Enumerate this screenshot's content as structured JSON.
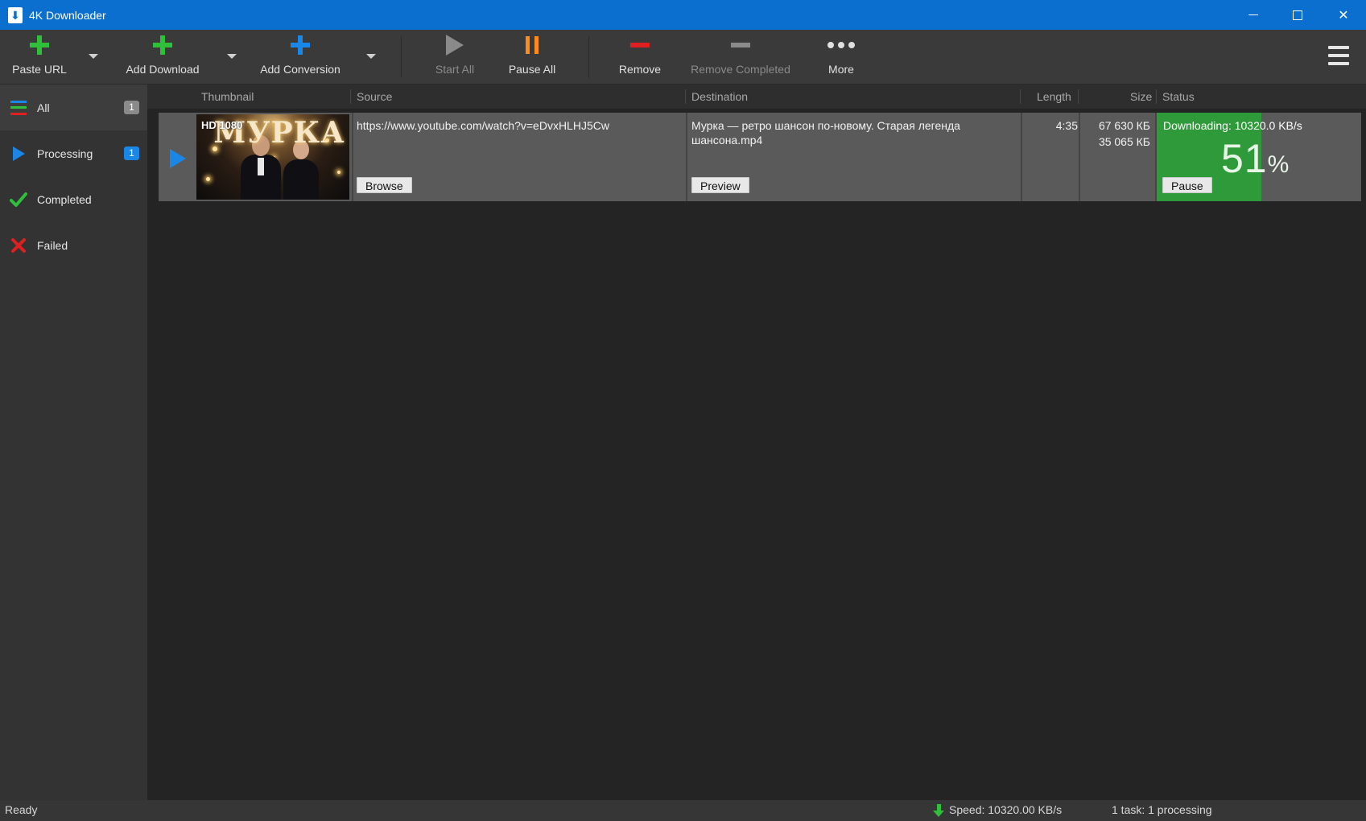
{
  "window": {
    "title": "4K Downloader",
    "accent_color": "#0a6fce"
  },
  "toolbar": {
    "paste_url": "Paste URL",
    "add_download": "Add Download",
    "add_conversion": "Add Conversion",
    "start_all": "Start All",
    "pause_all": "Pause All",
    "remove": "Remove",
    "remove_completed": "Remove Completed",
    "more": "More",
    "icons": {
      "paste_url": "plus-green-icon",
      "add_download": "plus-green-icon",
      "add_conversion": "plus-blue-icon",
      "start_all": "play-icon",
      "pause_all": "pause-icon",
      "remove": "minus-red-icon",
      "remove_completed": "minus-gray-icon",
      "more": "more-dots-icon",
      "menu": "hamburger-icon"
    },
    "colors": {
      "green": "#2fbf3a",
      "blue": "#1a86e6",
      "orange": "#ff8c1a",
      "red": "#e02020",
      "disabled": "#8a8a8a"
    }
  },
  "sidebar": {
    "items": [
      {
        "label": "All",
        "badge": "1",
        "icon": "list-icon",
        "active": true
      },
      {
        "label": "Processing",
        "badge": "1",
        "icon": "play-icon",
        "active": false
      },
      {
        "label": "Completed",
        "badge": "",
        "icon": "check-icon",
        "active": false
      },
      {
        "label": "Failed",
        "badge": "",
        "icon": "x-icon",
        "active": false
      }
    ]
  },
  "table": {
    "columns": {
      "thumbnail": "Thumbnail",
      "source": "Source",
      "destination": "Destination",
      "length": "Length",
      "size": "Size",
      "status": "Status"
    },
    "rows": [
      {
        "thumbnail_badge": "HD 1080",
        "thumbnail_title": "МУРКА",
        "source": "https://www.youtube.com/watch?v=eDvxHLHJ5Cw",
        "browse_label": "Browse",
        "destination": "Мурка — ретро шансон по-новому. Старая легенда шансона.mp4",
        "preview_label": "Preview",
        "length": "4:35",
        "size_total": "67 630 КБ",
        "size_done": "35 065 КБ",
        "status_text": "Downloading: 10320.0 KB/s",
        "percent": "51",
        "percent_sign": "%",
        "progress": 0.51,
        "pause_label": "Pause",
        "progress_color": "#2f9a3a"
      }
    ]
  },
  "statusbar": {
    "ready": "Ready",
    "speed": "Speed: 10320.00 KB/s",
    "tasks": "1 task: 1 processing"
  }
}
